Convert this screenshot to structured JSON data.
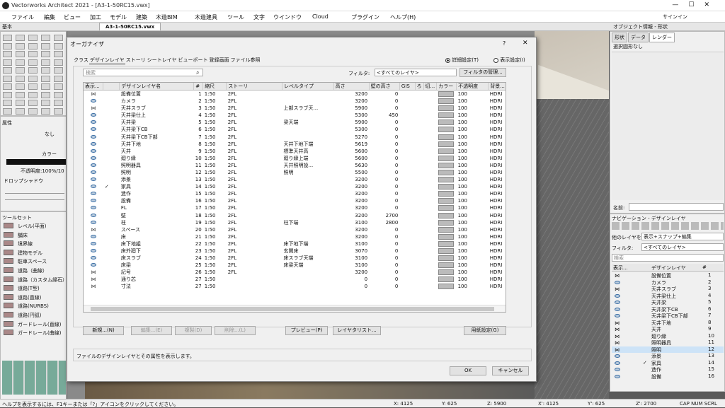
{
  "app": {
    "title": "Vectorworks Architect 2021 - [A3-1-50RC15.vwx]",
    "sign_in": "サインイン"
  },
  "menu": [
    "ファイル",
    "編集",
    "ビュー",
    "加工",
    "モデル",
    "建築",
    "木造BIM",
    "木造建具",
    "ツール",
    "文字",
    "ウインドウ",
    "Cloud",
    "プラグイン",
    "ヘルプ(H)"
  ],
  "doc_tab": "A3-1-50RC15.vwx",
  "left": {
    "basic": "基本",
    "attr": "属性",
    "nashi": "なし",
    "color": "カラー",
    "opacity": "不透明度:100%/10",
    "shadow": "ドロップシャドウ",
    "toolset": "ツールセット",
    "tools": [
      "レベル(平面)",
      "舗床",
      "境界線",
      "建物モデル",
      "駐車スペース",
      "道路（曲線）",
      "道路（カスタム縁石）",
      "道路(T型)",
      "道路(直線)",
      "道路(NURBS)",
      "道路(円弧)",
      "ガードレール(直線)",
      "ガードレール(曲線)"
    ]
  },
  "dialog": {
    "title": "オーガナイザ",
    "help": "?",
    "tabs": [
      "クラス",
      "デザインレイヤ",
      "ストーリ",
      "シートレイヤ",
      "ビューポート",
      "登録画面",
      "ファイル参照"
    ],
    "radio_detail": "詳細設定(T)",
    "radio_display": "表示設定(I)",
    "search_ph": "検索",
    "filter_label": "フィルタ:",
    "filter_value": "<すべてのレイヤ>",
    "filter_manage": "フィルタの管理...",
    "columns": [
      "表示...",
      "",
      "デザインレイヤ名",
      "#",
      "縮尺",
      "ストーリ",
      "レベルタイプ",
      "高さ",
      "壁の高さ",
      "GIS",
      "ろ",
      "切...",
      "カラー",
      "不透明度",
      "背景..."
    ],
    "rows": [
      {
        "v": "x",
        "c": "",
        "n": "設備位置",
        "i": "1",
        "s": "1:50",
        "st": "2FL",
        "lt": "",
        "h": "3200",
        "w": "0",
        "o": "100",
        "b": "HDRI"
      },
      {
        "v": "e",
        "c": "",
        "n": "カメラ",
        "i": "2",
        "s": "1:50",
        "st": "2FL",
        "lt": "",
        "h": "3200",
        "w": "0",
        "o": "100",
        "b": "HDRI"
      },
      {
        "v": "x",
        "c": "",
        "n": "天井スラブ",
        "i": "3",
        "s": "1:50",
        "st": "2FL",
        "lt": "上部スラブ天...",
        "h": "5900",
        "w": "0",
        "o": "100",
        "b": "HDRI"
      },
      {
        "v": "e",
        "c": "",
        "n": "天井梁仕上",
        "i": "4",
        "s": "1:50",
        "st": "2FL",
        "lt": "",
        "h": "5300",
        "w": "450",
        "o": "100",
        "b": "HDRI"
      },
      {
        "v": "e",
        "c": "",
        "n": "天井梁",
        "i": "5",
        "s": "1:50",
        "st": "2FL",
        "lt": "梁天端",
        "h": "5900",
        "w": "0",
        "o": "100",
        "b": "HDRI"
      },
      {
        "v": "e",
        "c": "",
        "n": "天井梁下CB",
        "i": "6",
        "s": "1:50",
        "st": "2FL",
        "lt": "",
        "h": "5300",
        "w": "0",
        "o": "100",
        "b": "HDRI"
      },
      {
        "v": "e",
        "c": "",
        "n": "天井梁下CB下部",
        "i": "7",
        "s": "1:50",
        "st": "2FL",
        "lt": "",
        "h": "5270",
        "w": "0",
        "o": "100",
        "b": "HDRI"
      },
      {
        "v": "e",
        "c": "",
        "n": "天井下地",
        "i": "8",
        "s": "1:50",
        "st": "2FL",
        "lt": "天井下地下端",
        "h": "5619",
        "w": "0",
        "o": "100",
        "b": "HDRI"
      },
      {
        "v": "e",
        "c": "",
        "n": "天井",
        "i": "9",
        "s": "1:50",
        "st": "2FL",
        "lt": "標準天井高",
        "h": "5600",
        "w": "0",
        "o": "100",
        "b": "HDRI"
      },
      {
        "v": "e",
        "c": "",
        "n": "廻り縁",
        "i": "10",
        "s": "1:50",
        "st": "2FL",
        "lt": "廻り縁上端",
        "h": "5600",
        "w": "0",
        "o": "100",
        "b": "HDRI"
      },
      {
        "v": "e",
        "c": "",
        "n": "照明器具",
        "i": "11",
        "s": "1:50",
        "st": "2FL",
        "lt": "天井照明設...",
        "h": "5630",
        "w": "0",
        "o": "100",
        "b": "HDRI"
      },
      {
        "v": "e",
        "c": "",
        "n": "照明",
        "i": "12",
        "s": "1:50",
        "st": "2FL",
        "lt": "照明",
        "h": "5500",
        "w": "0",
        "o": "100",
        "b": "HDRI"
      },
      {
        "v": "e",
        "c": "",
        "n": "添景",
        "i": "13",
        "s": "1:50",
        "st": "2FL",
        "lt": "",
        "h": "3200",
        "w": "0",
        "o": "100",
        "b": "HDRI"
      },
      {
        "v": "e",
        "c": "✓",
        "n": "家具",
        "i": "14",
        "s": "1:50",
        "st": "2FL",
        "lt": "",
        "h": "3200",
        "w": "0",
        "o": "100",
        "b": "HDRI"
      },
      {
        "v": "e",
        "c": "",
        "n": "造作",
        "i": "15",
        "s": "1:50",
        "st": "2FL",
        "lt": "",
        "h": "3200",
        "w": "0",
        "o": "100",
        "b": "HDRI"
      },
      {
        "v": "e",
        "c": "",
        "n": "設備",
        "i": "16",
        "s": "1:50",
        "st": "2FL",
        "lt": "",
        "h": "3200",
        "w": "0",
        "o": "100",
        "b": "HDRI"
      },
      {
        "v": "e",
        "c": "",
        "n": "FL",
        "i": "17",
        "s": "1:50",
        "st": "2FL",
        "lt": "",
        "h": "3200",
        "w": "0",
        "o": "100",
        "b": "HDRI"
      },
      {
        "v": "e",
        "c": "",
        "n": "壁",
        "i": "18",
        "s": "1:50",
        "st": "2FL",
        "lt": "",
        "h": "3200",
        "w": "2700",
        "o": "100",
        "b": "HDRI"
      },
      {
        "v": "e",
        "c": "",
        "n": "柱",
        "i": "19",
        "s": "1:50",
        "st": "2FL",
        "lt": "柱下端",
        "h": "3100",
        "w": "2800",
        "o": "100",
        "b": "HDRI"
      },
      {
        "v": "x",
        "c": "",
        "n": "スペース",
        "i": "20",
        "s": "1:50",
        "st": "2FL",
        "lt": "",
        "h": "3200",
        "w": "0",
        "o": "100",
        "b": "HDRI"
      },
      {
        "v": "e",
        "c": "",
        "n": "床",
        "i": "21",
        "s": "1:50",
        "st": "2FL",
        "lt": "",
        "h": "3200",
        "w": "0",
        "o": "100",
        "b": "HDRI"
      },
      {
        "v": "e",
        "c": "",
        "n": "床下地組",
        "i": "22",
        "s": "1:50",
        "st": "2FL",
        "lt": "床下地下端",
        "h": "3100",
        "w": "0",
        "o": "100",
        "b": "HDRI"
      },
      {
        "v": "e",
        "c": "",
        "n": "床外廻下",
        "i": "23",
        "s": "1:50",
        "st": "2FL",
        "lt": "玄関床",
        "h": "3070",
        "w": "0",
        "o": "100",
        "b": "HDRI"
      },
      {
        "v": "e",
        "c": "",
        "n": "床スラブ",
        "i": "24",
        "s": "1:50",
        "st": "2FL",
        "lt": "床スラブ天端",
        "h": "3100",
        "w": "0",
        "o": "100",
        "b": "HDRI"
      },
      {
        "v": "e",
        "c": "",
        "n": "床梁",
        "i": "25",
        "s": "1:50",
        "st": "2FL",
        "lt": "床梁天端",
        "h": "3100",
        "w": "0",
        "o": "100",
        "b": "HDRI"
      },
      {
        "v": "x",
        "c": "",
        "n": "記号",
        "i": "26",
        "s": "1:50",
        "st": "2FL",
        "lt": "",
        "h": "3200",
        "w": "0",
        "o": "100",
        "b": "HDRI"
      },
      {
        "v": "x",
        "c": "",
        "n": "通り芯",
        "i": "27",
        "s": "1:50",
        "st": "",
        "lt": "",
        "h": "0",
        "w": "0",
        "o": "100",
        "b": "HDRI"
      },
      {
        "v": "x",
        "c": "",
        "n": "寸法",
        "i": "27",
        "s": "1:50",
        "st": "",
        "lt": "",
        "h": "0",
        "w": "0",
        "o": "100",
        "b": "HDRI"
      }
    ],
    "buttons": {
      "new": "新規...(N)",
      "edit": "編集...(E)",
      "dup": "複製(D)",
      "del": "削除...(L)",
      "preview": "プレビュー(P)",
      "layerlist": "レイヤタリスト...",
      "paper": "用紙設定(G)",
      "ok": "OK",
      "cancel": "キャンセル"
    },
    "desc": "ファイルのデザインレイヤとその属性を表示します。"
  },
  "right": {
    "obj_title": "オブジェクト情報 - 形状",
    "tabs": [
      "形状",
      "データ",
      "レンダー"
    ],
    "nosel": "選択図形なし",
    "name_label": "名前:",
    "nav_title": "ナビゲーション - デザインレイヤ",
    "other_label": "他のレイヤを:",
    "other_value": "表示+スナップ+編集",
    "filter_label": "フィルタ:",
    "filter_value": "<すべてのレイヤ>",
    "search_ph": "検索",
    "col_disp": "表示...",
    "col_name": "デザインレイヤ",
    "col_num": "#",
    "layers": [
      {
        "v": "x",
        "n": "設備位置",
        "i": "1"
      },
      {
        "v": "e",
        "n": "カメラ",
        "i": "2"
      },
      {
        "v": "x",
        "n": "天井スラブ",
        "i": "3"
      },
      {
        "v": "e",
        "n": "天井梁仕上",
        "i": "4"
      },
      {
        "v": "e",
        "n": "天井梁",
        "i": "5"
      },
      {
        "v": "e",
        "n": "天井梁下CB",
        "i": "6"
      },
      {
        "v": "e",
        "n": "天井梁下CB下部",
        "i": "7"
      },
      {
        "v": "x",
        "n": "天井下地",
        "i": "8"
      },
      {
        "v": "x",
        "n": "天井",
        "i": "9"
      },
      {
        "v": "x",
        "n": "廻り縁",
        "i": "10"
      },
      {
        "v": "x",
        "n": "照明器具",
        "i": "11"
      },
      {
        "v": "x",
        "n": "照明",
        "i": "12"
      },
      {
        "v": "e",
        "n": "添景",
        "i": "13"
      },
      {
        "v": "e",
        "n": "家具",
        "i": "14"
      },
      {
        "v": "e",
        "n": "造作",
        "i": "15"
      },
      {
        "v": "e",
        "n": "設備",
        "i": "16"
      }
    ]
  },
  "status": {
    "hint": "ヘルプを表示するには、F1キーまたは「?」アイコンをクリックしてください。",
    "x": "X: 4125",
    "y": "Y: 625",
    "z": "Z: 5900",
    "x2": "X': 4125",
    "y2": "Y': 625",
    "z2": "Z': 2700",
    "caps": "CAP NUM SCRL"
  }
}
